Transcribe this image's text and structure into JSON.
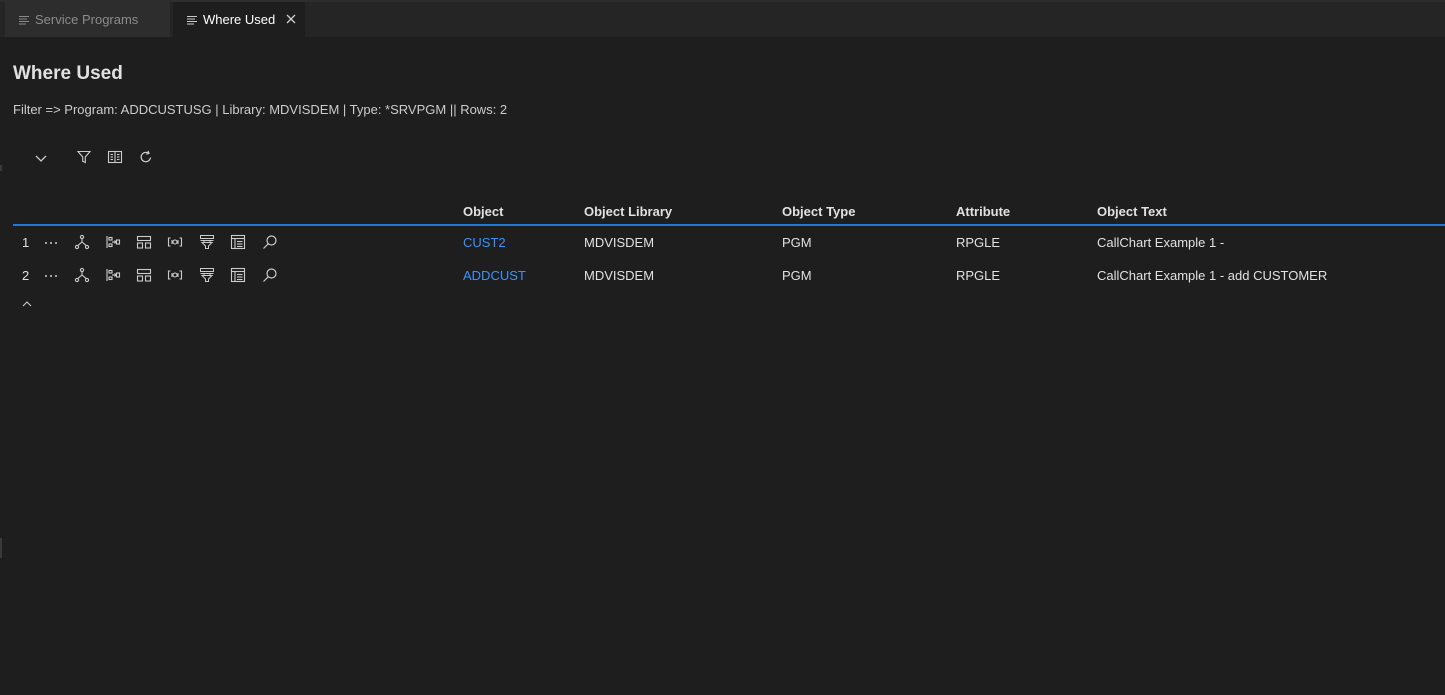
{
  "tabs": [
    {
      "label": "Service Programs",
      "icon": "list-icon",
      "active": false
    },
    {
      "label": "Where Used",
      "icon": "list-icon",
      "active": true
    }
  ],
  "page": {
    "title": "Where Used",
    "filter": "Filter => Program: ADDCUSTUSG | Library: MDVISDEM | Type: *SRVPGM || Rows: 2"
  },
  "toolbar": [
    "chevron-down-icon",
    "filter-icon",
    "columns-icon",
    "refresh-icon"
  ],
  "table": {
    "columns": [
      "Object",
      "Object Library",
      "Object Type",
      "Attribute",
      "Object Text"
    ],
    "row_actions": [
      "more-icon",
      "hierarchy-icon",
      "flow-icon",
      "layout-icon",
      "code-icon",
      "filter-grid-icon",
      "table-icon",
      "search-icon"
    ],
    "rows": [
      {
        "num": "1",
        "object": "CUST2",
        "library": "MDVISDEM",
        "type": "PGM",
        "attribute": "RPGLE",
        "text": "CallChart Example 1 -"
      },
      {
        "num": "2",
        "object": "ADDCUST",
        "library": "MDVISDEM",
        "type": "PGM",
        "attribute": "RPGLE",
        "text": "CallChart Example 1 - add CUSTOMER"
      }
    ],
    "collapse_icon": "chevron-up-icon"
  },
  "colors": {
    "accent": "#1f7ad6",
    "link": "#3794ff",
    "background": "#1e1e1e"
  }
}
